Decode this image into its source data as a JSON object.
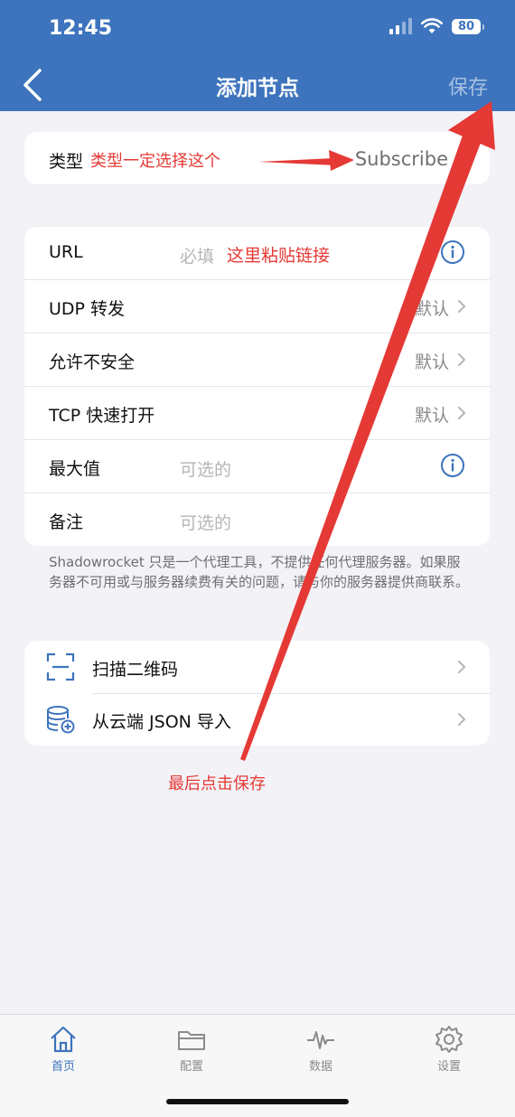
{
  "status": {
    "time": "12:45",
    "battery": "80"
  },
  "nav": {
    "title": "添加节点",
    "save_label": "保存"
  },
  "type_row": {
    "label": "类型",
    "note": "类型一定选择这个",
    "value": "Subscribe"
  },
  "form": {
    "url": {
      "label": "URL",
      "placeholder": "必填",
      "note": "这里粘贴链接"
    },
    "udp": {
      "label": "UDP 转发",
      "value": "默认"
    },
    "insecure": {
      "label": "允许不安全",
      "value": "默认"
    },
    "tfo": {
      "label": "TCP 快速打开",
      "value": "默认"
    },
    "max": {
      "label": "最大值",
      "placeholder": "可选的"
    },
    "remark": {
      "label": "备注",
      "placeholder": "可选的"
    }
  },
  "footnote": "Shadowrocket 只是一个代理工具，不提供任何代理服务器。如果服务器不可用或与服务器续费有关的问题，请与你的服务器提供商联系。",
  "actions": [
    {
      "label": "扫描二维码",
      "icon": "qr-scan-icon"
    },
    {
      "label": "从云端 JSON 导入",
      "icon": "database-add-icon"
    }
  ],
  "annotation": {
    "save_hint": "最后点击保存",
    "color": "#e53935"
  },
  "tabs": [
    {
      "label": "首页",
      "icon": "home-icon",
      "active": true
    },
    {
      "label": "配置",
      "icon": "folder-icon",
      "active": false
    },
    {
      "label": "数据",
      "icon": "pulse-icon",
      "active": false
    },
    {
      "label": "设置",
      "icon": "gear-icon",
      "active": false
    }
  ],
  "colors": {
    "accent": "#3d74bd",
    "background": "#f2f2f7",
    "annotation_red": "#e53935"
  }
}
